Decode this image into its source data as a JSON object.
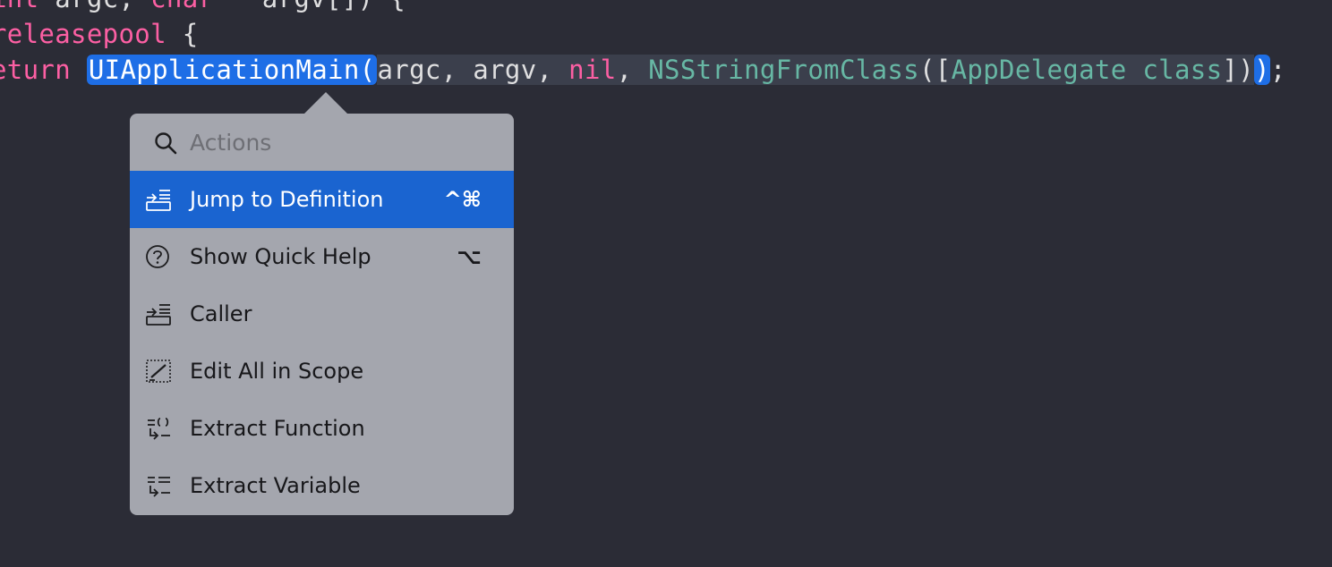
{
  "code": {
    "line1": {
      "t1": "int",
      "t2": " argc, ",
      "t3": "char",
      "t4": " * argv[]) {"
    },
    "line2": {
      "t1": "releasepool",
      "t2": " {"
    },
    "line3": {
      "t1": "eturn",
      "t2": " ",
      "t3": "UIApplicationMain(",
      "t4": "argc, argv, ",
      "t5": "nil",
      "t6": ", ",
      "t7": "NSStringFromClass",
      "t8": "([",
      "t9": "AppDelegate",
      "t10": " ",
      "t11": "class",
      "t12": "])",
      "t13": ")",
      "t14": ";"
    }
  },
  "popover": {
    "search": {
      "icon": "search-icon",
      "placeholder": "Actions",
      "value": ""
    },
    "items": [
      {
        "label": "Jump to Definition",
        "shortcut": "^⌘",
        "icon": "jump-to-definition-icon",
        "active": true
      },
      {
        "label": "Show Quick Help",
        "shortcut": "⌥",
        "icon": "question-circle-icon",
        "active": false
      },
      {
        "label": "Caller",
        "shortcut": "",
        "icon": "caller-icon",
        "active": false
      },
      {
        "label": "Edit All in Scope",
        "shortcut": "",
        "icon": "edit-scope-icon",
        "active": false
      },
      {
        "label": "Extract Function",
        "shortcut": "",
        "icon": "extract-function-icon",
        "active": false
      },
      {
        "label": "Extract Variable",
        "shortcut": "",
        "icon": "extract-variable-icon",
        "active": false
      }
    ]
  },
  "colors": {
    "editor_background": "#2b2c36",
    "keyword": "#fc5fa3",
    "type_name": "#67b7a4",
    "selection": "#1e6ee6",
    "popover_background": "#a4a6ae",
    "active_item": "#1a64d0"
  }
}
